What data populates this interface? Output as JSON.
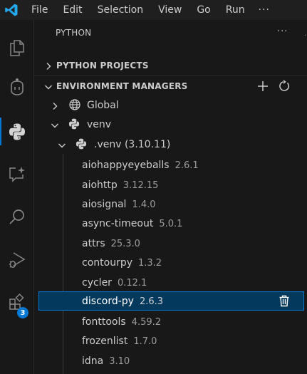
{
  "menu": {
    "items": [
      "File",
      "Edit",
      "Selection",
      "View",
      "Go",
      "Run"
    ],
    "more": "···"
  },
  "activity": {
    "items": [
      "explorer-icon",
      "copilot-icon",
      "python-icon",
      "chat-sparkle-icon",
      "search-icon",
      "run-debug-icon",
      "extensions-icon"
    ],
    "extensions_badge": "3",
    "active": "python-icon"
  },
  "sidebar": {
    "title": "PYTHON",
    "more": "···",
    "sections": {
      "projects": "PYTHON PROJECTS",
      "managers": "ENVIRONMENT MANAGERS"
    },
    "tree": {
      "global": "Global",
      "venv": "venv",
      "env": ".venv (3.10.11)"
    },
    "packages": [
      {
        "name": "aiohappyeyeballs",
        "version": "2.6.1"
      },
      {
        "name": "aiohttp",
        "version": "3.12.15"
      },
      {
        "name": "aiosignal",
        "version": "1.4.0"
      },
      {
        "name": "async-timeout",
        "version": "5.0.1"
      },
      {
        "name": "attrs",
        "version": "25.3.0"
      },
      {
        "name": "contourpy",
        "version": "1.3.2"
      },
      {
        "name": "cycler",
        "version": "0.12.1"
      },
      {
        "name": "discord-py",
        "version": "2.6.3"
      },
      {
        "name": "fonttools",
        "version": "4.59.2"
      },
      {
        "name": "frozenlist",
        "version": "1.7.0"
      },
      {
        "name": "idna",
        "version": "3.10"
      }
    ],
    "selected_package": "discord-py"
  },
  "colors": {
    "accent": "#0078d4",
    "selection_bg": "#04395e",
    "vscode_blue": "#23a9f2"
  }
}
